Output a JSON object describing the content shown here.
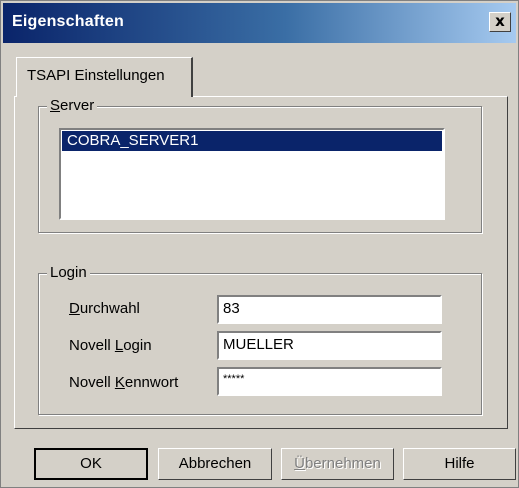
{
  "window": {
    "title": "Eigenschaften",
    "close_glyph": "x"
  },
  "tab": {
    "label": "TSAPI Einstellungen"
  },
  "server_group": {
    "label_mnemonic": "S",
    "label_rest": "erver",
    "items": [
      "COBRA_SERVER1"
    ]
  },
  "login_group": {
    "label": "Login",
    "fields": [
      {
        "label_pre": "",
        "mnemonic": "D",
        "label_post": "urchwahl",
        "value": "83"
      },
      {
        "label_pre": "Novell ",
        "mnemonic": "L",
        "label_post": "ogin",
        "value": "MUELLER"
      },
      {
        "label_pre": "Novell ",
        "mnemonic": "K",
        "label_post": "ennwort",
        "value": "*****"
      }
    ]
  },
  "buttons": {
    "ok": "OK",
    "cancel": "Abbrechen",
    "apply_mnemonic": "Ü",
    "apply_rest": "bernehmen",
    "help": "Hilfe"
  },
  "colors": {
    "titlebar_start": "#0a246a",
    "titlebar_end": "#a6caf0",
    "selection": "#0a246a",
    "face": "#d4d0c8"
  }
}
